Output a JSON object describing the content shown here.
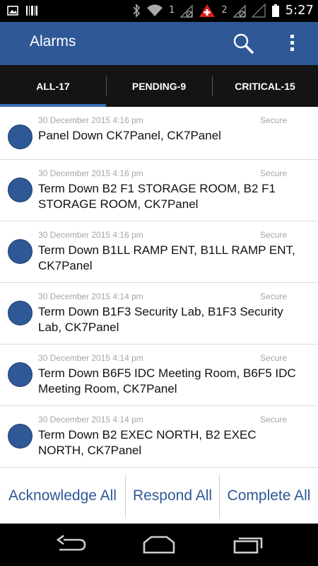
{
  "status_bar": {
    "time": "5:27",
    "sim1_number": "1",
    "sim2_number": "2",
    "icons": [
      "image-icon",
      "barcode-icon",
      "bluetooth-icon",
      "wifi-icon",
      "signal-icon",
      "swiss-flag-icon",
      "no-signal-icon"
    ]
  },
  "app_bar": {
    "title": "Alarms",
    "icons": [
      "search-icon",
      "overflow-menu-icon"
    ]
  },
  "tabs": [
    {
      "label": "ALL-17",
      "selected": true
    },
    {
      "label": "PENDING-9",
      "selected": false
    },
    {
      "label": "CRITICAL-15",
      "selected": false
    }
  ],
  "alarms": [
    {
      "timestamp": "30 December 2015 4:16 pm",
      "status": "Secure",
      "message": "Panel Down CK7Panel, CK7Panel"
    },
    {
      "timestamp": "30 December 2015 4:16 pm",
      "status": "Secure",
      "message": "Term Down B2 F1 STORAGE ROOM, B2 F1 STORAGE ROOM, CK7Panel"
    },
    {
      "timestamp": "30 December 2015 4:16 pm",
      "status": "Secure",
      "message": "Term Down B1LL RAMP ENT, B1LL RAMP ENT, CK7Panel"
    },
    {
      "timestamp": "30 December 2015 4:14 pm",
      "status": "Secure",
      "message": "Term Down B1F3 Security Lab, B1F3 Security Lab, CK7Panel"
    },
    {
      "timestamp": "30 December 2015 4:14 pm",
      "status": "Secure",
      "message": "Term Down B6F5 IDC Meeting Room, B6F5 IDC Meeting Room, CK7Panel"
    },
    {
      "timestamp": "30 December 2015 4:14 pm",
      "status": "Secure",
      "message": "Term Down B2 EXEC NORTH, B2 EXEC NORTH, CK7Panel"
    }
  ],
  "actions": {
    "acknowledge_all": "Acknowledge All",
    "respond_all": "Respond All",
    "complete_all": "Complete All"
  },
  "colors": {
    "app_bar": "#2f5896",
    "tab_bar": "#141414",
    "tab_indicator": "#3b6db5",
    "status_dot": "#2f5896",
    "action_text": "#2f5896"
  },
  "nav_bar": {
    "icons": [
      "back-icon",
      "home-icon",
      "recents-icon"
    ]
  }
}
